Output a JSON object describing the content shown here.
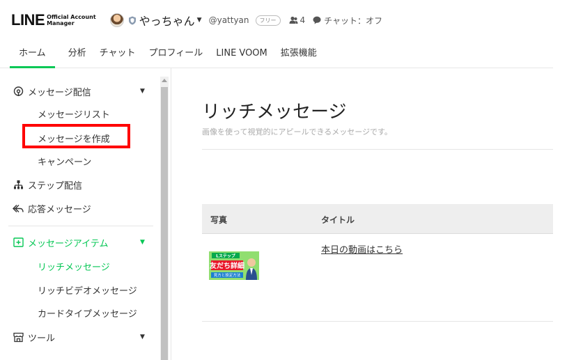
{
  "header": {
    "logo_text": "LINE",
    "logo_sub_1": "Official Account",
    "logo_sub_2": "Manager",
    "account_name": "やっちゃん",
    "account_id": "@yattyan",
    "plan_badge": "フリー",
    "friend_count": "4",
    "chat_status": "チャット：オフ"
  },
  "nav": {
    "tabs": [
      {
        "label": "ホーム",
        "active": true
      },
      {
        "label": "分析"
      },
      {
        "label": "チャット"
      },
      {
        "label": "プロフィール"
      },
      {
        "label": "LINE VOOM"
      },
      {
        "label": "拡張機能"
      }
    ]
  },
  "sidebar": {
    "message_delivery": "メッセージ配信",
    "message_list": "メッセージリスト",
    "create_message": "メッセージを作成",
    "campaign": "キャンペーン",
    "step_delivery": "ステップ配信",
    "auto_reply": "応答メッセージ",
    "message_items": "メッセージアイテム",
    "rich_message": "リッチメッセージ",
    "rich_video": "リッチビデオメッセージ",
    "card_message": "カードタイプメッセージ",
    "tools": "ツール"
  },
  "main": {
    "title": "リッチメッセージ",
    "description": "画像を使って視覚的にアピールできるメッセージです。",
    "table": {
      "col_photo": "写真",
      "col_title": "タイトル",
      "rows": [
        {
          "title": "本日の動画はこちら",
          "thumb_line1": "Lステップ",
          "thumb_line2": "友だち詳細",
          "thumb_line3": "見方と設定方法"
        }
      ]
    }
  },
  "colors": {
    "accent": "#06c755",
    "highlight": "#ff0000"
  }
}
